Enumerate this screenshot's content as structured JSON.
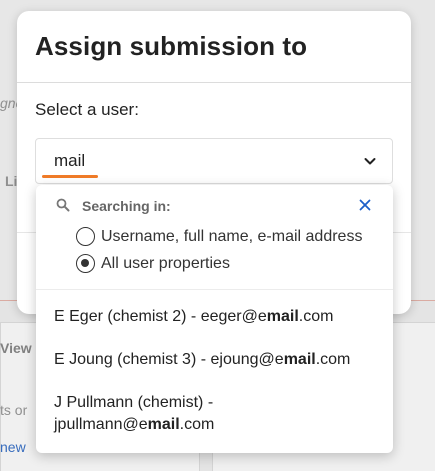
{
  "background": {
    "fragments": [
      "gne",
      "Li",
      "View",
      "ts or",
      "new"
    ]
  },
  "modal": {
    "title": "Assign submission to",
    "field_label": "Select a user:",
    "select_value": "mail"
  },
  "dropdown": {
    "searching_label": "Searching in:",
    "options": [
      {
        "label": "Username, full name, e-mail address",
        "checked": false
      },
      {
        "label": "All user properties",
        "checked": true
      }
    ],
    "results": [
      {
        "before": "E Eger (chemist 2) - eeger@e",
        "match": "mail",
        "after": ".com"
      },
      {
        "before": "E Joung (chemist 3) - ejoung@e",
        "match": "mail",
        "after": ".com"
      },
      {
        "before": "J Pullmann (chemist) -",
        "line2_before": "jpullmann@e",
        "match": "mail",
        "after": ".com"
      }
    ]
  },
  "colors": {
    "accent_underline": "#f07b28",
    "close_icon": "#1d5fc9",
    "link": "#3b73c9"
  }
}
